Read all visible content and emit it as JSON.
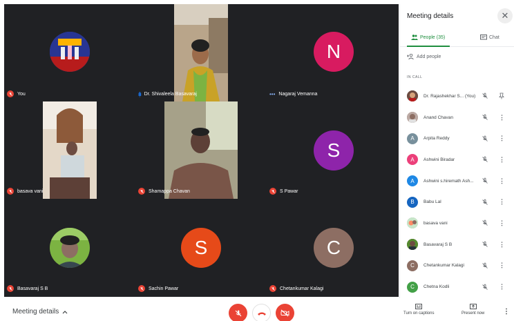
{
  "tiles": [
    {
      "name": "You",
      "kind": "photo-circle",
      "muted": true
    },
    {
      "name": "Dr. Shivaleela Basavaraj",
      "kind": "video",
      "speaking": true
    },
    {
      "name": "Nagaraj Vemanna",
      "kind": "letter",
      "letter": "N",
      "color": "#d81b60",
      "more": true
    },
    {
      "name": "basava vani",
      "kind": "video",
      "muted": true
    },
    {
      "name": "Shamappa Chavan",
      "kind": "video",
      "muted": true
    },
    {
      "name": "S Pawar",
      "kind": "letter",
      "letter": "S",
      "color": "#8e24aa",
      "muted": true
    },
    {
      "name": "Basavaraj S B",
      "kind": "photo-circle",
      "muted": true
    },
    {
      "name": "Sachin Pawar",
      "kind": "letter",
      "letter": "S",
      "color": "#e64a19",
      "muted": true
    },
    {
      "name": "Chetankumar Kalagi",
      "kind": "letter",
      "letter": "C",
      "color": "#8d6e63",
      "muted": true
    }
  ],
  "bottom_bar": {
    "meeting_details_label": "Meeting details",
    "captions_label": "Turn on captions",
    "present_label": "Present now"
  },
  "panel": {
    "title": "Meeting details",
    "tab_people": "People (35)",
    "tab_chat": "Chat",
    "add_people": "Add people",
    "section_label": "IN CALL",
    "participants": [
      {
        "name": "Dr. Rajashekhar S...",
        "you": "(You)",
        "avatar": "photo",
        "color": "#6d4c41"
      },
      {
        "name": "Anand Chavan",
        "avatar": "photo",
        "color": "#a1887f"
      },
      {
        "name": "Arpita Reddy",
        "avatar": "letter",
        "letter": "A",
        "color": "#78909c"
      },
      {
        "name": "Ashwini Biradar",
        "avatar": "letter",
        "letter": "A",
        "color": "#ec407a"
      },
      {
        "name": "Ashwini s.hiremath Ash...",
        "avatar": "letter",
        "letter": "A",
        "color": "#1e88e5"
      },
      {
        "name": "Babu Lal",
        "avatar": "letter",
        "letter": "B",
        "color": "#1565c0"
      },
      {
        "name": "basava vani",
        "avatar": "photo",
        "color": "#9e9e9e"
      },
      {
        "name": "Basavaraj S B",
        "avatar": "photo",
        "color": "#5d4037"
      },
      {
        "name": "Chetankumar Kalagi",
        "avatar": "letter",
        "letter": "C",
        "color": "#8d6e63"
      },
      {
        "name": "Chetna Kodli",
        "avatar": "letter",
        "letter": "C",
        "color": "#43a047"
      }
    ]
  }
}
